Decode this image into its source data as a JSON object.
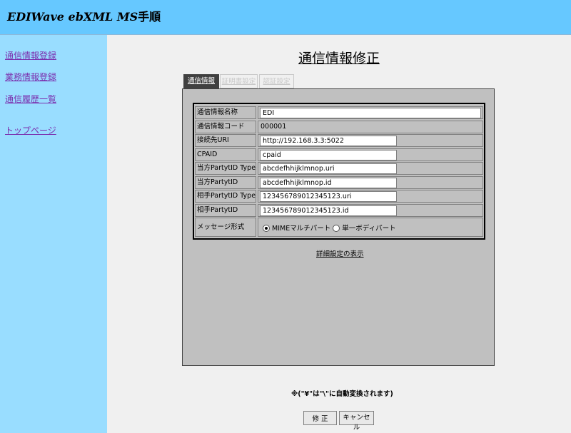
{
  "header": {
    "title": "EDIWave ebXML MS",
    "title_jp": "手順"
  },
  "sidebar": {
    "items": [
      {
        "label": "通信情報登録"
      },
      {
        "label": "業務情報登録"
      },
      {
        "label": "通信履歴一覧"
      },
      {
        "label": "トップページ"
      }
    ]
  },
  "page_title": "通信情報修正",
  "tabs": [
    {
      "label": "通信情報"
    },
    {
      "label": "証明書設定"
    },
    {
      "label": "認証設定"
    }
  ],
  "form": {
    "rows": [
      {
        "label": "通信情報名称",
        "value": "EDI"
      },
      {
        "label": "通信情報コード",
        "value": "000001"
      },
      {
        "label": "接続先URI",
        "value": "http://192.168.3.3:5022"
      },
      {
        "label": "CPAID",
        "value": "cpaid"
      },
      {
        "label": "当方PartytID Type",
        "value": "abcdefhhijklmnop.uri"
      },
      {
        "label": "当方PartytID",
        "value": "abcdefhhijklmnop.id"
      },
      {
        "label": "相手PartytID Type",
        "value": "123456789012345123.uri"
      },
      {
        "label": "相手PartytID",
        "value": "123456789012345123.id"
      }
    ],
    "message_format": {
      "label": "メッセージ形式",
      "options": [
        {
          "label": "MIMEマルチパート",
          "selected": true
        },
        {
          "label": "単一ボディパート",
          "selected": false
        }
      ]
    }
  },
  "detail_link": "詳細設定の表示",
  "note": "※(\"¥\"は\"\\\"に自動変換されます)",
  "buttons": {
    "submit": "修 正",
    "cancel": "キャンセル"
  }
}
